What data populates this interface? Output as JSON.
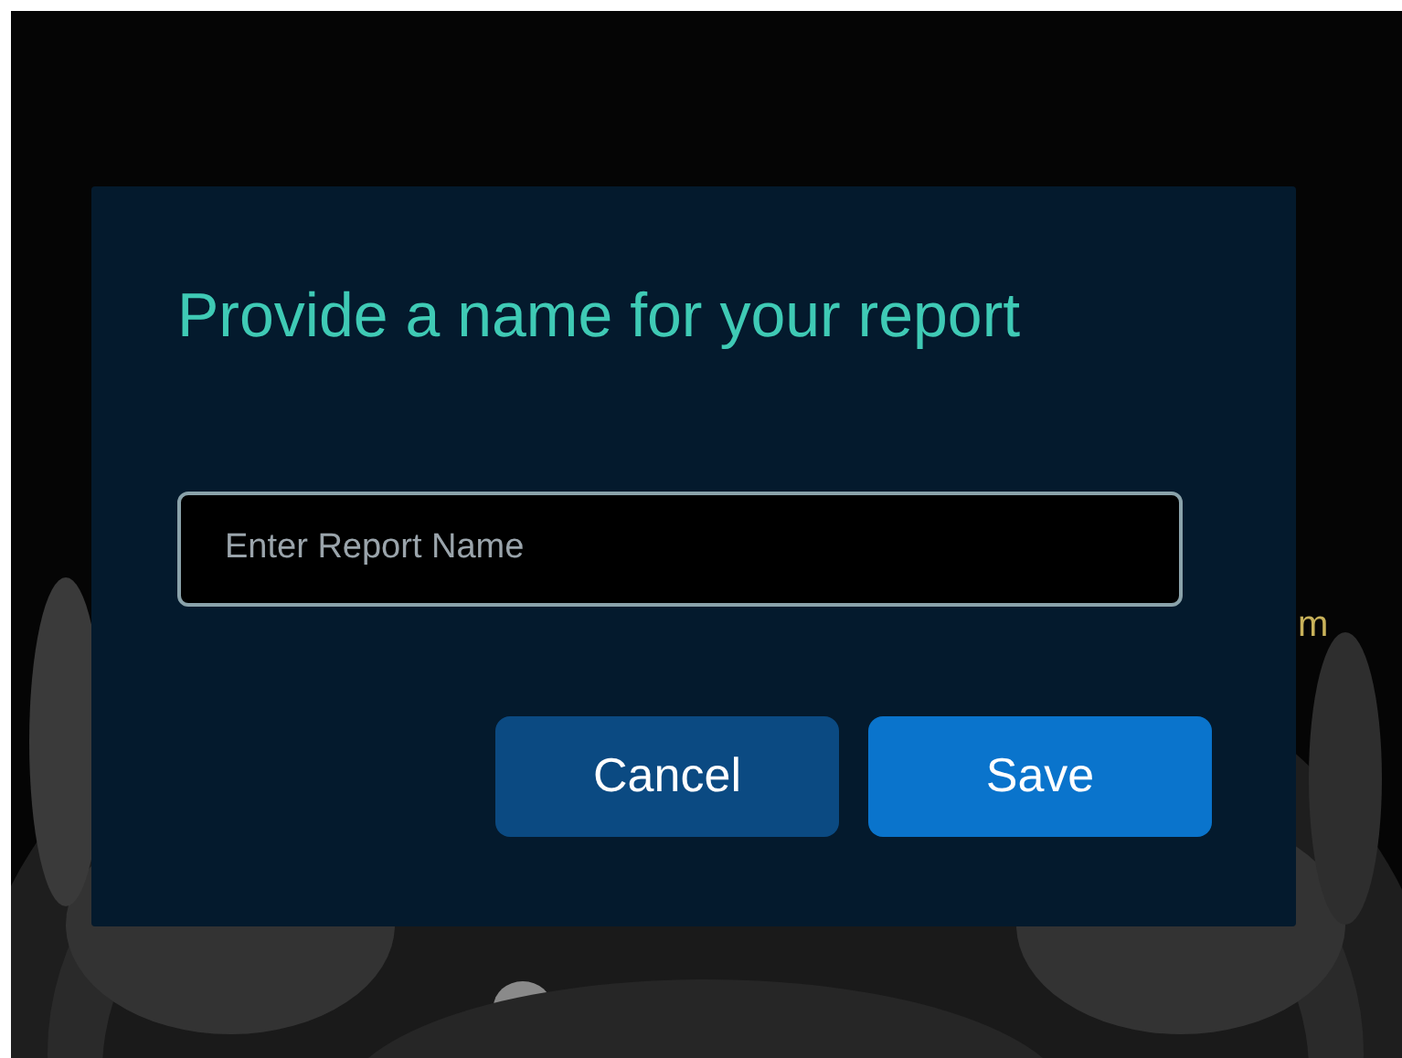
{
  "background": {
    "kind": "picture",
    "overlay_text": "m"
  },
  "dialog": {
    "title": "Provide a name for your report",
    "field": {
      "placeholder": "Enter Report Name"
    },
    "buttons": [
      {
        "label": "Cancel",
        "kind": "secondary"
      },
      {
        "label": "Save",
        "kind": "primary"
      }
    ]
  }
}
